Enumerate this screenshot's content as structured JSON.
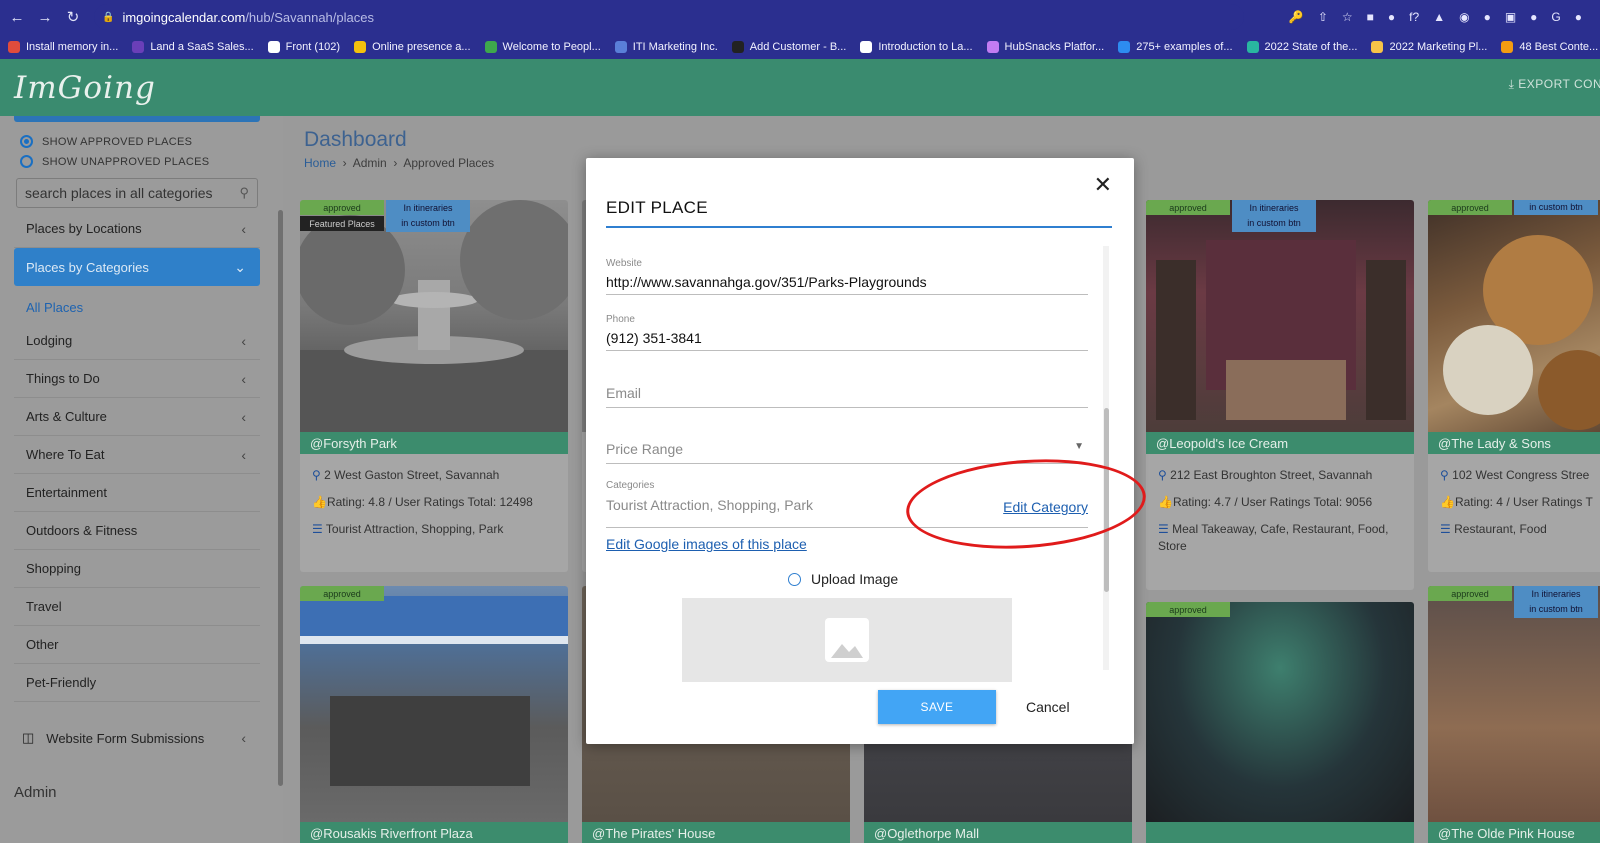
{
  "browser": {
    "url_host": "imgoingcalendar.com",
    "url_path": "/hub/Savannah/places",
    "bookmarks": [
      {
        "label": "Install memory in...",
        "color": "#e04c3c"
      },
      {
        "label": "Land a SaaS Sales...",
        "color": "#6a3fb8"
      },
      {
        "label": "Front (102)",
        "color": "#ffffff"
      },
      {
        "label": "Online presence a...",
        "color": "#f4c20d"
      },
      {
        "label": "Welcome to Peopl...",
        "color": "#3ea84c"
      },
      {
        "label": "ITI Marketing Inc.",
        "color": "#5a7fd8"
      },
      {
        "label": "Add Customer - B...",
        "color": "#222222"
      },
      {
        "label": "Introduction to La...",
        "color": "#ffffff"
      },
      {
        "label": "HubSnacks Platfor...",
        "color": "#c27cf2"
      },
      {
        "label": "275+ examples of...",
        "color": "#2d8cf0"
      },
      {
        "label": "2022 State of the...",
        "color": "#29b6a0"
      },
      {
        "label": "2022 Marketing Pl...",
        "color": "#f7c348"
      },
      {
        "label": "48 Best Conte...",
        "color": "#f39c12"
      }
    ]
  },
  "app": {
    "logo": "ImGoing",
    "export_label": "EXPORT CONT"
  },
  "sidebar": {
    "show_approved": "SHOW APPROVED PLACES",
    "show_unapproved": "SHOW UNAPPROVED PLACES",
    "search_placeholder": "search places in all categories",
    "places_by_locations": "Places by Locations",
    "places_by_categories": "Places by Categories",
    "all_places": "All Places",
    "items": [
      "Lodging",
      "Things to Do",
      "Arts & Culture",
      "Where To Eat",
      "Entertainment",
      "Outdoors & Fitness",
      "Shopping",
      "Travel",
      "Other",
      "Pet-Friendly"
    ],
    "website_forms": "Website Form Submissions",
    "admin": "Admin"
  },
  "main": {
    "title": "Dashboard",
    "breadcrumb": [
      "Home",
      "Admin",
      "Approved Places"
    ]
  },
  "cards": [
    {
      "name": "@Forsyth Park",
      "address": "2 West Gaston Street, Savannah",
      "rating": "Rating: 4.8 / User Ratings Total: 12498",
      "categories": "Tourist Attraction, Shopping, Park",
      "tags": [
        "approved",
        "In itineraries",
        "in custom btn",
        "Featured Places"
      ]
    },
    {
      "name": "@Leopold's Ice Cream",
      "address": "212 East Broughton Street, Savannah",
      "rating": "Rating: 4.7 / User Ratings Total: 9056",
      "categories": "Meal Takeaway, Cafe, Restaurant, Food, Store",
      "tags": [
        "approved",
        "In itineraries",
        "in custom btn"
      ]
    },
    {
      "name": "@The Lady & Sons",
      "address": "102 West Congress Stree",
      "rating": "Rating: 4 / User Ratings T",
      "categories": "Restaurant, Food",
      "tags": [
        "approved",
        "in custom btn"
      ]
    },
    {
      "name": "@Rousakis Riverfront Plaza",
      "tags": [
        "approved"
      ]
    },
    {
      "name": "@The Pirates' House"
    },
    {
      "name": "@Oglethorpe Mall"
    },
    {
      "name": "",
      "tags": [
        "approved"
      ]
    },
    {
      "name": "@The Olde Pink House",
      "tags": [
        "approved",
        "In itineraries",
        "in custom btn"
      ]
    }
  ],
  "modal": {
    "title": "EDIT PLACE",
    "website_label": "Website",
    "website_value": "http://www.savannahga.gov/351/Parks-Playgrounds",
    "phone_label": "Phone",
    "phone_value": "(912) 351-3841",
    "email_placeholder": "Email",
    "price_placeholder": "Price Range",
    "categories_label": "Categories",
    "categories_value": "Tourist Attraction, Shopping, Park",
    "edit_category": "Edit Category",
    "edit_google_images": "Edit Google images of this place",
    "upload_image": "Upload Image",
    "save": "SAVE",
    "cancel": "Cancel"
  }
}
